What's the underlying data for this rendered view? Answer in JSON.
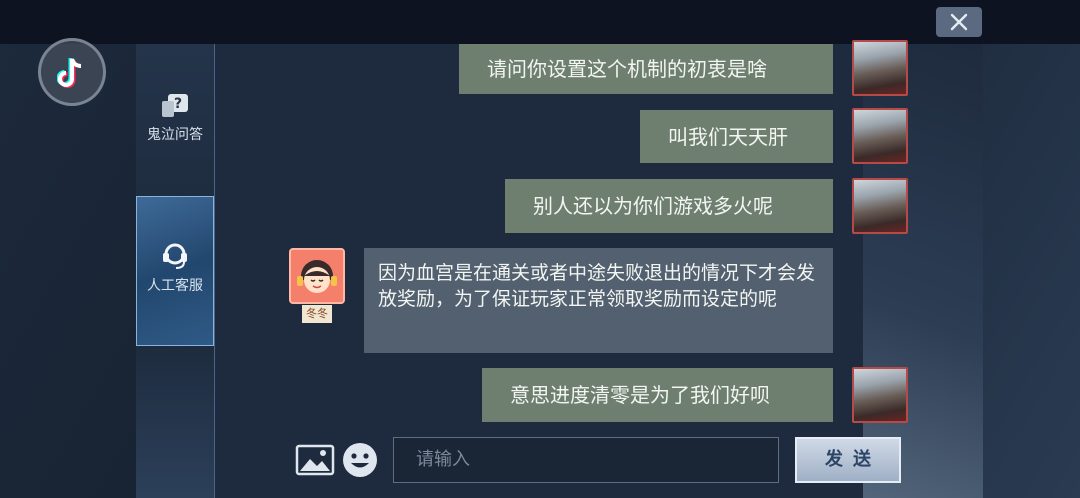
{
  "window": {
    "close_glyph": "✕"
  },
  "sidebar": {
    "items": [
      {
        "label": "鬼泣问答",
        "icon": "question-chat-icon"
      },
      {
        "label": "人工客服",
        "icon": "headset-icon"
      }
    ]
  },
  "chat": {
    "messages": [
      {
        "sender": "user",
        "text": "请问你设置这个机制的初衷是啥"
      },
      {
        "sender": "user",
        "text": "叫我们天天肝"
      },
      {
        "sender": "user",
        "text": "别人还以为你们游戏多火呢"
      },
      {
        "sender": "service",
        "text": "因为血宫是在通关或者中途失败退出的情况下才会发放奖励，为了保证玩家正常领取奖励而设定的呢",
        "name": "冬冬"
      },
      {
        "sender": "user",
        "text": "意思进度清零是为了我们好呗"
      }
    ]
  },
  "composer": {
    "placeholder": "请输入",
    "send_label": "发送",
    "image_icon": "image-icon",
    "emoji_icon": "emoji-icon"
  },
  "colors": {
    "user_bubble": "#6e7f6f",
    "service_bubble": "#52606f",
    "accent": "#8ab4de"
  }
}
